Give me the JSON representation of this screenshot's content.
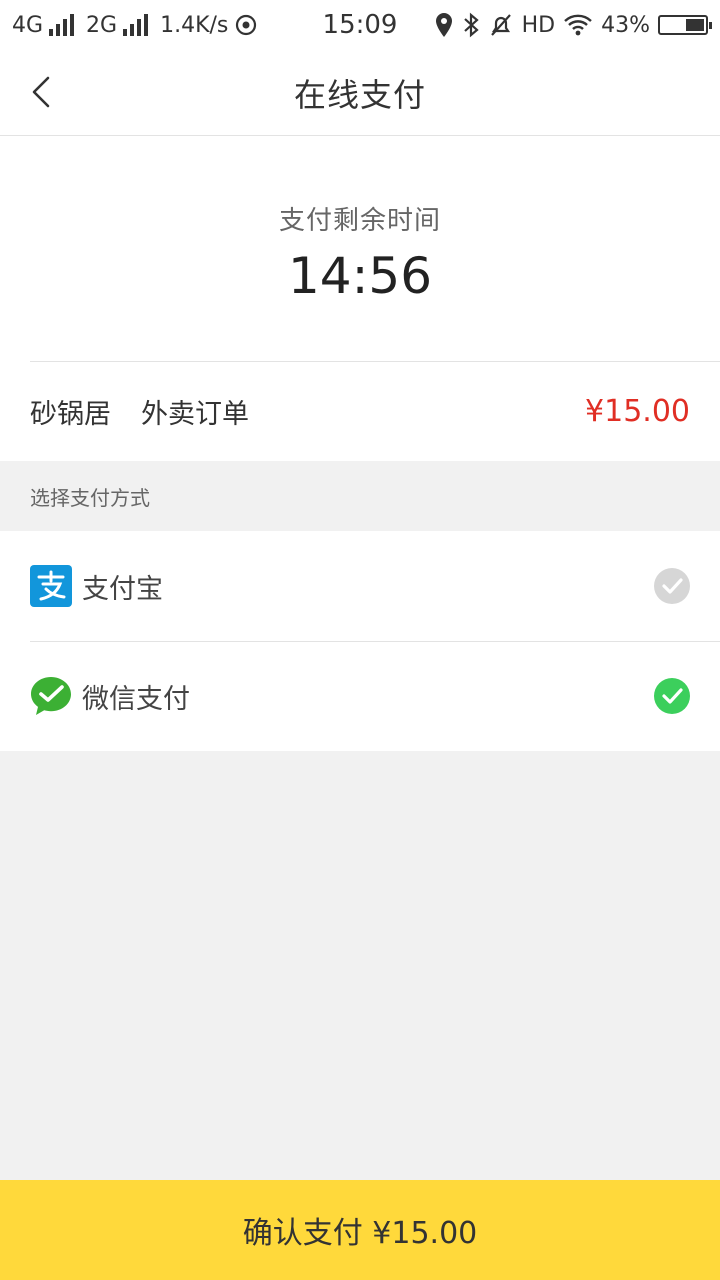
{
  "status_bar": {
    "network_1": "4G",
    "network_2": "2G",
    "speed": "1.4K/s",
    "time": "15:09",
    "hd": "HD",
    "battery": "43%",
    "battery_level": 0.43
  },
  "header": {
    "title": "在线支付",
    "back_icon": "chevron-left-icon"
  },
  "timer": {
    "label": "支付剩余时间",
    "value": "14:56"
  },
  "order": {
    "shop": "砂锅居",
    "type": "外卖订单",
    "price": "¥15.00"
  },
  "payment": {
    "section_title": "选择支付方式",
    "methods": [
      {
        "label": "支付宝",
        "icon": "alipay-icon",
        "selected": false
      },
      {
        "label": "微信支付",
        "icon": "wechat-pay-icon",
        "selected": true
      }
    ]
  },
  "footer": {
    "confirm_label": "确认支付 ¥15.00"
  },
  "colors": {
    "accent_yellow": "#ffd93b",
    "price_red": "#e02e24",
    "check_green": "#3ccf5c",
    "check_gray": "#d6d6d6",
    "alipay_blue": "#1296db",
    "wechat_green": "#3cb034"
  }
}
